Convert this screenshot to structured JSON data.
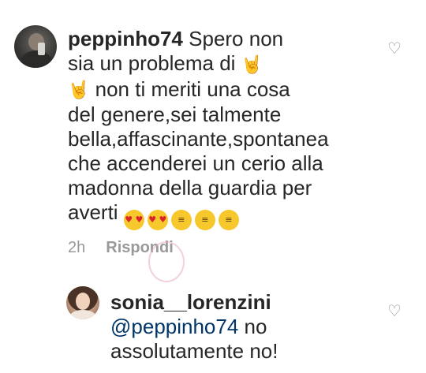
{
  "comment": {
    "username": "peppinho74",
    "lines": [
      "Spero non",
      "sia un problema di",
      "non ti meriti una cosa",
      "del genere,sei talmente",
      "bella,affascinante,spontanea",
      "che accenderei un cerio alla",
      "madonna della guardia per",
      "averti"
    ],
    "emoji": {
      "rock_hand": "🤘",
      "heart_eyes": "😍",
      "grin": "😁"
    },
    "time": "2h",
    "reply_label": "Rispondi"
  },
  "reply": {
    "username": "sonia__lorenzini",
    "mention": "@peppinho74",
    "lines": [
      "no",
      "assolutamente no!"
    ]
  },
  "icons": {
    "like": "heart-outline-icon"
  },
  "colors": {
    "text": "#262626",
    "meta": "#999999",
    "mention": "#003569",
    "icon": "#8e8e8e"
  }
}
